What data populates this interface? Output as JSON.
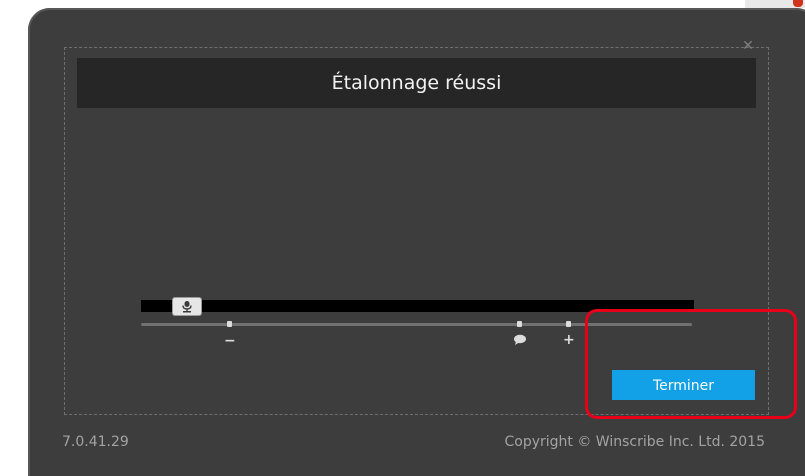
{
  "dialog": {
    "title": "Étalonnage réussi",
    "close_icon": "close-icon"
  },
  "meter": {
    "level": 0.06,
    "thumb_icon": "microphone-icon",
    "scale": {
      "minus_label": "−",
      "plus_label": "+",
      "speech_icon": "speech-bubble-icon"
    }
  },
  "actions": {
    "finish_label": "Terminer",
    "accent_color": "#12a0e6"
  },
  "footer": {
    "version": "7.0.41.29",
    "copyright": "Copyright © Winscribe Inc. Ltd. 2015"
  },
  "annotation": {
    "highlight_color": "#e8001a"
  }
}
